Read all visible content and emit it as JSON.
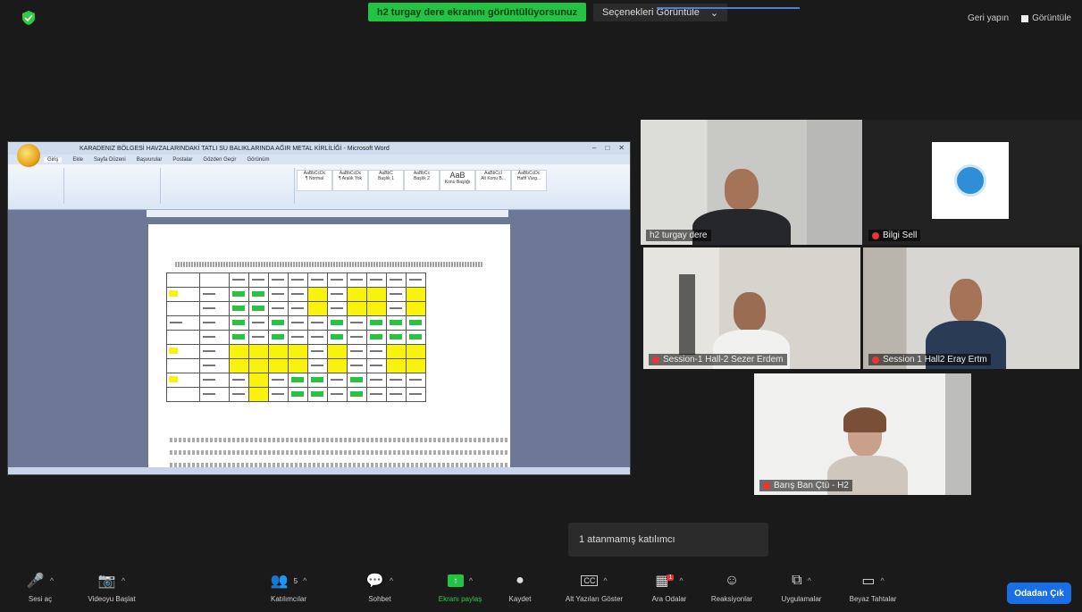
{
  "top_bar": {
    "share_banner": "h2 turgay dere ekranını görüntülüyorsunuz",
    "view_options": "Seçenekleri Görüntüle",
    "view_options_caret": "⌄",
    "right_items": [
      {
        "label": "Geri yapın"
      },
      {
        "label": "Görüntüle"
      }
    ],
    "shield_color": "#2ecc40"
  },
  "shared_document": {
    "app": "Microsoft Word",
    "window_title": "KARADENIZ BÖLGESİ HAVZALARINDAKİ TATLI SU BALIKLARINDA AĞIR METAL KİRLİLİĞİ - Microsoft Word",
    "ribbon_tabs": [
      "Giriş",
      "Ekle",
      "Sayfa Düzeni",
      "Başvurular",
      "Postalar",
      "Gözden Geçir",
      "Görünüm"
    ],
    "style_boxes": [
      "AaBbCcDc",
      "AaBbCcDc",
      "AaBbC",
      "AaBbCc",
      "AaB",
      "AaBbCcI",
      "AaBbCcDc"
    ],
    "style_names": [
      "¶ Normal",
      "¶ Aralık Yok",
      "Başlık 1",
      "Başlık 2",
      "Konu Başlığı",
      "Alt Konu B...",
      "Hafif Vurg..."
    ]
  },
  "participants": [
    {
      "name": "h2 turgay dere",
      "active": true,
      "muted": false
    },
    {
      "name": "Bilgi Sell",
      "active": false,
      "muted": true
    },
    {
      "name": "Session-1 Hall-2 Sezer Erdem",
      "active": false,
      "muted": true
    },
    {
      "name": "Session 1 Hall2 Eray Ertm",
      "active": false,
      "muted": true
    },
    {
      "name": "Barış Ban Çtü - H2",
      "active": false,
      "muted": true
    }
  ],
  "tooltip": "1 atanmamış katılımcı",
  "toolbar": {
    "items": [
      {
        "label": "Sesi aç",
        "icon": "🎤"
      },
      {
        "label": "Videoyu Başlat",
        "icon": "📷"
      },
      {
        "label": "Katılımcılar",
        "icon": "👥",
        "count": "5"
      },
      {
        "label": "Sohbet",
        "icon": "💬"
      },
      {
        "label": "Ekranı paylaş",
        "icon": "↑"
      },
      {
        "label": "Kaydet",
        "icon": "●"
      },
      {
        "label": "Alt Yazıları Göster",
        "icon": "CC"
      },
      {
        "label": "Ara Odalar",
        "icon": "▦",
        "badge": "1"
      },
      {
        "label": "Reaksiyonlar",
        "icon": "☺"
      },
      {
        "label": "Uygulamalar",
        "icon": "⧉"
      },
      {
        "label": "Beyaz Tahtalar",
        "icon": "▭"
      }
    ],
    "leave": "Odadan Çık"
  }
}
